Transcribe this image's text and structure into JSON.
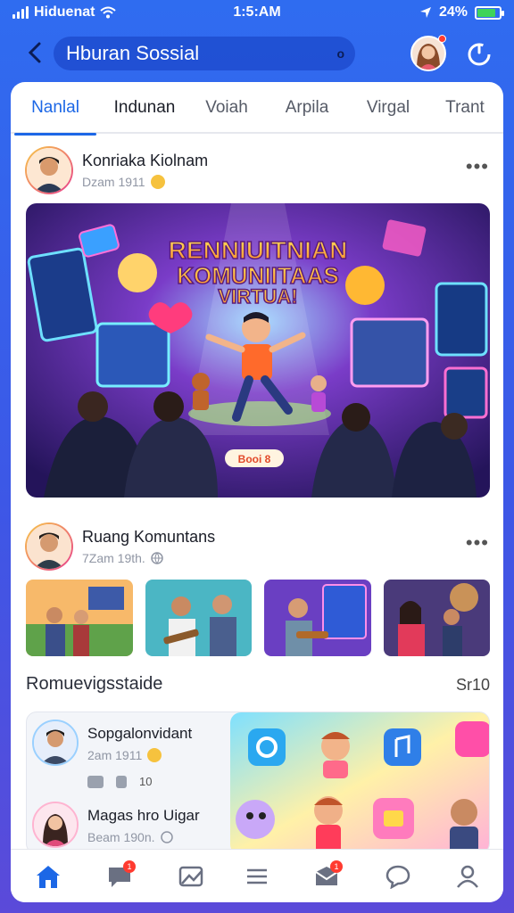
{
  "status_bar": {
    "carrier": "Hiduenat",
    "time": "1:5:AM",
    "battery_text": "24%",
    "battery_level": 0.85
  },
  "header": {
    "title": "Hburan Sossial",
    "title_trailing": "o",
    "back_icon": "chevron-left-icon",
    "refresh_icon": "refresh-icon"
  },
  "tabs": [
    {
      "label": "Nanlal",
      "active": true
    },
    {
      "label": "Indunan",
      "active": false
    },
    {
      "label": "Voiah",
      "active": false
    },
    {
      "label": "Arpila",
      "active": false
    },
    {
      "label": "Virgal",
      "active": false
    },
    {
      "label": "Trant",
      "active": false
    }
  ],
  "post1": {
    "author": "Konriaka Kiolnam",
    "meta": "Dzam 1911",
    "banner": {
      "line1": "RENNIUITNIAN",
      "line2": "KOMUNIITAAS",
      "line3": "VIRTUA!",
      "pill": "Booi 8"
    }
  },
  "post2": {
    "author": "Ruang Komuntans",
    "meta": "7Zam 19th."
  },
  "section": {
    "title": "Romuevigsstaide",
    "count": "Sr10"
  },
  "subposts": [
    {
      "name": "Sopgalonvidant",
      "meta": "2am 1911",
      "actions": [
        "",
        "",
        "10"
      ]
    },
    {
      "name": "Magas hro Uigar",
      "meta": "Beam 190n."
    }
  ],
  "bottom_nav": [
    {
      "icon": "home-icon",
      "active": true,
      "badge": ""
    },
    {
      "icon": "chat-bubble-icon",
      "active": false,
      "badge": "1"
    },
    {
      "icon": "image-icon",
      "active": false,
      "badge": ""
    },
    {
      "icon": "menu-icon",
      "active": false,
      "badge": ""
    },
    {
      "icon": "heart-mail-icon",
      "active": false,
      "badge": "1"
    },
    {
      "icon": "comment-icon",
      "active": false,
      "badge": ""
    },
    {
      "icon": "profile-icon",
      "active": false,
      "badge": ""
    }
  ],
  "colors": {
    "accent": "#1c67e6",
    "bg_top": "#2f6cf0",
    "bg_bottom": "#5b4ad9",
    "badge": "#ff3b30"
  }
}
